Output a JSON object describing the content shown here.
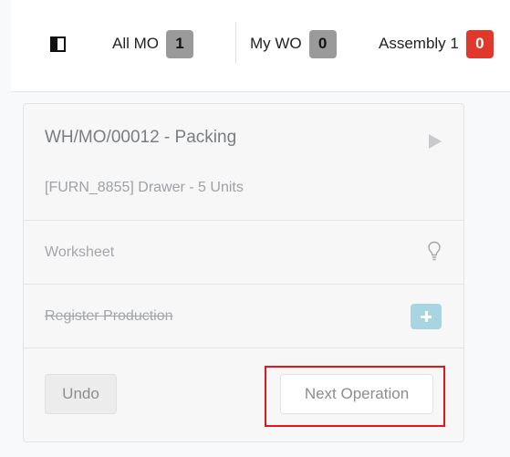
{
  "topbar": {
    "filters": [
      {
        "label": "All MO",
        "count": "1",
        "badge_color": "#9a9a9a"
      },
      {
        "label": "My WO",
        "count": "0",
        "badge_color": "#9a9a9a"
      },
      {
        "label": "Assembly 1",
        "count": "0",
        "badge_color": "#e0392b"
      }
    ]
  },
  "card": {
    "title": "WH/MO/00012 - Packing",
    "subtitle": "[FURN_8855] Drawer - 5 Units",
    "worksheet_label": "Worksheet",
    "register_label": "Register Production",
    "undo_label": "Undo",
    "next_label": "Next Operation"
  },
  "colors": {
    "badge_gray": "#9a9a9a",
    "badge_red": "#e0392b",
    "plus_button": "#a8d5e2",
    "highlight": "#e01818"
  }
}
